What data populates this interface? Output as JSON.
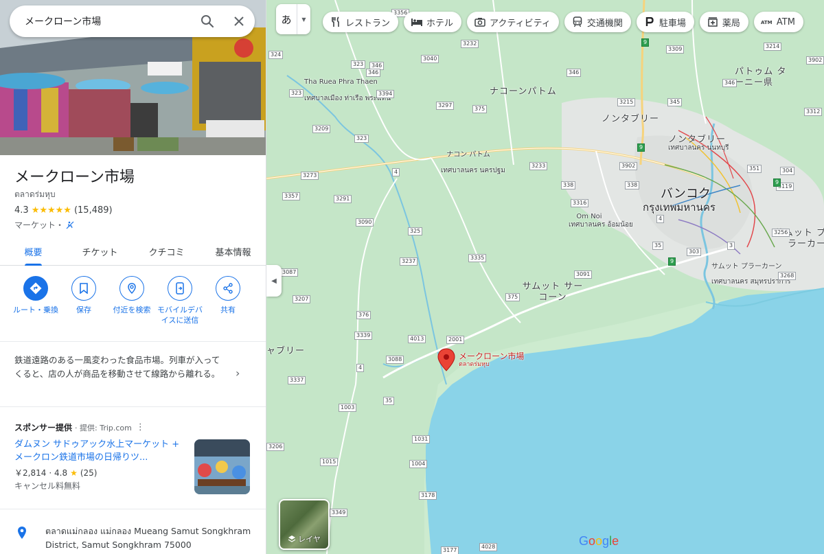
{
  "search": {
    "query": "メークローン市場"
  },
  "place": {
    "title": "メークローン市場",
    "native_name": "ตลาดร่มหุบ",
    "rating": "4.3",
    "stars": "★★★★★",
    "reviews": "(15,489)",
    "category": "マーケット・"
  },
  "tabs": [
    {
      "label": "概要"
    },
    {
      "label": "チケット"
    },
    {
      "label": "クチコミ"
    },
    {
      "label": "基本情報"
    }
  ],
  "actions": [
    {
      "label": "ルート・乗換",
      "icon": "directions-icon"
    },
    {
      "label": "保存",
      "icon": "bookmark-icon"
    },
    {
      "label": "付近を検索",
      "icon": "nearby-icon"
    },
    {
      "label": "モバイルデバイスに送信",
      "icon": "send-to-phone-icon"
    },
    {
      "label": "共有",
      "icon": "share-icon"
    }
  ],
  "description": "鉄道遠路のある一風変わった食品市場。列車が入ってくると、店の人が商品を移動させて線路から離れる。",
  "sponsor": {
    "heading": "スポンサー提供",
    "provider": "· 提供: Trip.com",
    "ad_title": "ダムヌン サドゥアック水上マーケット + メークロン鉄道市場の日帰りツ...",
    "price": "￥2,814",
    "rating": "· 4.8",
    "star": "★",
    "reviews": "(25)",
    "note": "キャンセル料無料"
  },
  "address": "ตลาดแม่กลอง แม่กลอง Mueang Samut Songkhram District, Samut Songkhram 75000",
  "map": {
    "lang_button": "あ",
    "chips": [
      {
        "label": "レストラン",
        "icon": "restaurant-icon"
      },
      {
        "label": "ホテル",
        "icon": "hotel-icon"
      },
      {
        "label": "アクティビティ",
        "icon": "camera-icon"
      },
      {
        "label": "交通機関",
        "icon": "transit-icon"
      },
      {
        "label": "駐車場",
        "icon": "parking-icon"
      },
      {
        "label": "薬局",
        "icon": "pharmacy-icon"
      },
      {
        "label": "ATM",
        "icon": "atm-icon"
      }
    ],
    "marker_label": "メークローン市場",
    "marker_sub": "ตลาดร่มหุบ",
    "layers_label": "レイヤ",
    "logo": "Google",
    "places": {
      "nakhon_pathom": "ナコーンパトム",
      "nonthaburi": "ノンタブリー",
      "pathum_thani": "パトゥム ターニー県",
      "nonthaburi2": "ノンタブリー",
      "nonthaburi2_th": "เทศบาลนคร นนทบุรี",
      "bangkok": "バンコク",
      "bangkok_th": "กรุงเทพมหานคร",
      "samut_sakhon": "サムット サーコーン",
      "samut_prakan_big": "サムット プラーカー",
      "tha_ruea": "Tha Ruea Phra Thaen",
      "tha_ruea_th": "เทศบาลเมือง ท่าเรือ พระแท่น",
      "nakhon_pathom_small": "ナコン パトム",
      "nakhon_pathom_th": "เทศบาลนคร นครปฐม",
      "om_noi": "Om Noi",
      "om_noi_th": "เทศบาลนคร อ้อมน้อย",
      "samut_prakan_small": "サムット プラーカーン",
      "samut_prakan_th": "เทศบาลนคร สมุทรปราการ",
      "ratchaburi": "ャブリー"
    },
    "roads": [
      "3356",
      "3232",
      "3040",
      "346",
      "346",
      "3394",
      "3297",
      "375",
      "346",
      "3309",
      "3214",
      "3902",
      "346",
      "3312",
      "345",
      "3215",
      "351",
      "304",
      "3119",
      "9",
      "3902",
      "3233",
      "338",
      "338",
      "3316",
      "4",
      "3256",
      "35",
      "303",
      "3",
      "3268",
      "3091",
      "375",
      "3237",
      "3335",
      "325",
      "4",
      "3090",
      "3291",
      "3357",
      "3273",
      "3209",
      "323",
      "323",
      "323",
      "324",
      "3087",
      "3207",
      "376",
      "3339",
      "4013",
      "2001",
      "3088",
      "4",
      "3337",
      "35",
      "1003",
      "1031",
      "3206",
      "1015",
      "1004",
      "3178",
      "3349",
      "3177",
      "4028",
      "9",
      "9",
      "9"
    ]
  }
}
